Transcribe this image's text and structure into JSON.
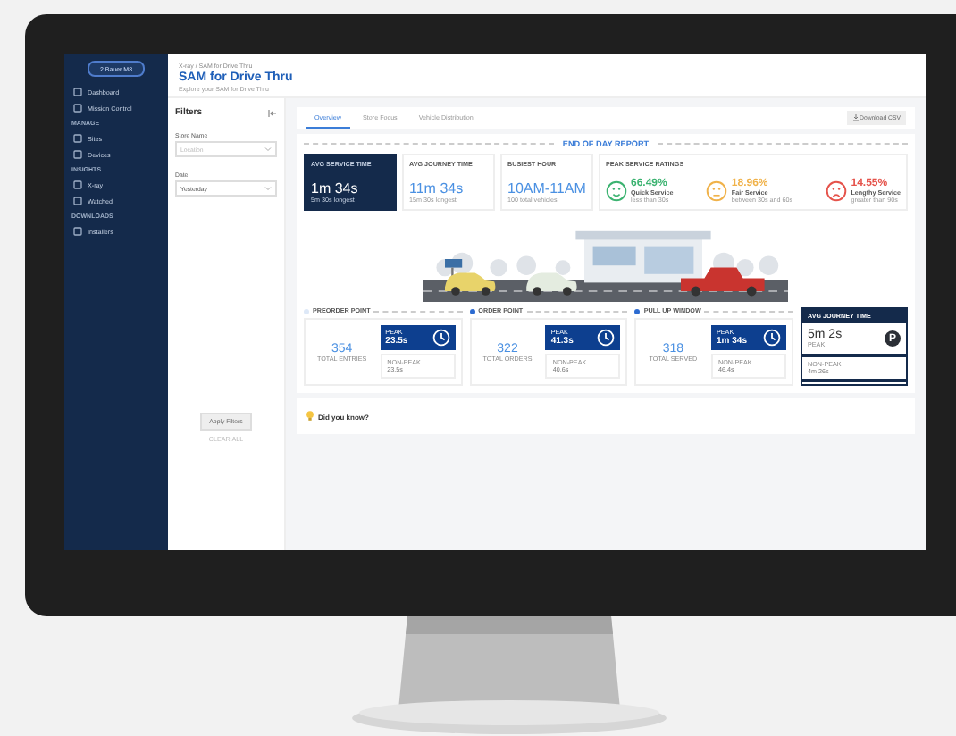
{
  "sidebar": {
    "button": "2 Bauer M8",
    "items": [
      {
        "kind": "link",
        "label": "Dashboard"
      },
      {
        "kind": "link",
        "label": "Mission Control"
      },
      {
        "kind": "section",
        "label": "MANAGE"
      },
      {
        "kind": "link",
        "label": "Sites"
      },
      {
        "kind": "link",
        "label": "Devices"
      },
      {
        "kind": "section",
        "label": "INSIGHTS"
      },
      {
        "kind": "link",
        "label": "X-ray"
      },
      {
        "kind": "link",
        "label": "Watched"
      },
      {
        "kind": "section",
        "label": "DOWNLOADS"
      },
      {
        "kind": "link",
        "label": "Installers"
      }
    ]
  },
  "header": {
    "breadcrumb": "X-ray / SAM for Drive Thru",
    "title": "SAM for Drive Thru",
    "subtitle": "Explore your SAM for Drive Thru"
  },
  "filters": {
    "title": "Filters",
    "fields": [
      {
        "label": "Store Name",
        "placeholder": "Location"
      },
      {
        "label": "Date",
        "value": "Yesterday"
      }
    ],
    "apply": "Apply Filters",
    "clear": "CLEAR ALL"
  },
  "tabs": [
    {
      "label": "Overview",
      "selected": true
    },
    {
      "label": "Store Focus",
      "selected": false
    },
    {
      "label": "Vehicle Distribution",
      "selected": false
    }
  ],
  "download": "Download CSV",
  "report": {
    "title": "END OF DAY REPORT",
    "kpis": [
      {
        "label": "AVG SERVICE TIME",
        "value": "1m 34s",
        "note": "5m 30s longest",
        "highlighted": true
      },
      {
        "label": "AVG JOURNEY TIME",
        "value": "11m 34s",
        "note": "15m 30s longest",
        "highlighted": false
      },
      {
        "label": "BUSIEST HOUR",
        "value": "10AM-11AM",
        "note": "100 total vehicles",
        "highlighted": false
      }
    ],
    "ratings_title": "PEAK SERVICE RATINGS",
    "ratings": [
      {
        "kind": "happy",
        "color": "#3cb371",
        "value": "66.49%",
        "label": "Quick Service",
        "note": "less than 30s"
      },
      {
        "kind": "neutral",
        "color": "#f0b24a",
        "value": "18.96%",
        "label": "Fair Service",
        "note": "between 30s and 60s"
      },
      {
        "kind": "sad",
        "color": "#e5534b",
        "value": "14.55%",
        "label": "Lengthy Service",
        "note": "greater than 90s"
      }
    ],
    "stages": [
      {
        "label": "PREORDER POINT",
        "count": "354",
        "count_label": "TOTAL ENTRIES",
        "peak_label": "PEAK",
        "peak": "23.5s",
        "nonpeak_label": "NON-PEAK",
        "nonpeak": "23.5s"
      },
      {
        "label": "ORDER POINT",
        "count": "322",
        "count_label": "TOTAL ORDERS",
        "peak_label": "PEAK",
        "peak": "41.3s",
        "nonpeak_label": "NON-PEAK",
        "nonpeak": "40.6s"
      },
      {
        "label": "PULL UP WINDOW",
        "count": "318",
        "count_label": "TOTAL SERVED",
        "peak_label": "PEAK",
        "peak": "1m 34s",
        "nonpeak_label": "NON-PEAK",
        "nonpeak": "46.4s"
      }
    ],
    "journey": {
      "label": "AVG JOURNEY TIME",
      "value": "5m 2s",
      "sub": "PEAK",
      "icon_letter": "P",
      "nonpeak_label": "NON-PEAK",
      "nonpeak": "4m 26s"
    }
  },
  "tip": {
    "title": "Did you know?"
  }
}
